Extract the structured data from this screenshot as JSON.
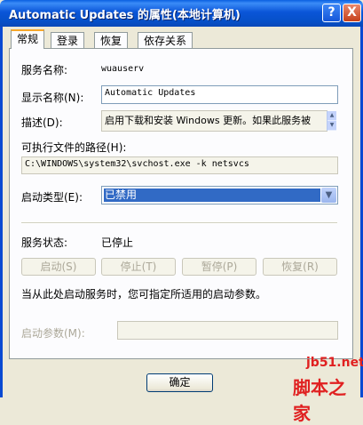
{
  "window": {
    "title": "Automatic Updates 的属性(本地计算机)"
  },
  "titlebar_buttons": {
    "help": "?",
    "close": "X"
  },
  "tabs": [
    {
      "label": "常规"
    },
    {
      "label": "登录"
    },
    {
      "label": "恢复"
    },
    {
      "label": "依存关系"
    }
  ],
  "general": {
    "service_name_label": "服务名称:",
    "service_name_value": "wuauserv",
    "display_name_label": "显示名称(N):",
    "display_name_value": "Automatic Updates",
    "description_label": "描述(D):",
    "description_value": "启用下载和安装 Windows 更新。如果此服务被",
    "exe_path_label": "可执行文件的路径(H):",
    "exe_path_value": "C:\\WINDOWS\\system32\\svchost.exe -k netsvcs",
    "startup_type_label": "启动类型(E):",
    "startup_type_value": "已禁用",
    "status_label": "服务状态:",
    "status_value": "已停止",
    "buttons": {
      "start": "启动(S)",
      "stop": "停止(T)",
      "pause": "暂停(P)",
      "resume": "恢复(R)"
    },
    "hint_text": "当从此处启动服务时，您可指定所适用的启动参数。",
    "start_params_label": "启动参数(M):",
    "start_params_value": ""
  },
  "footer": {
    "ok_label": "确定"
  },
  "watermark": {
    "line1": "jb51.net",
    "line2": "脚本之家"
  },
  "icons": [
    "help-icon",
    "close-icon",
    "chevron-down-icon",
    "scroll-up-icon",
    "scroll-down-icon"
  ]
}
